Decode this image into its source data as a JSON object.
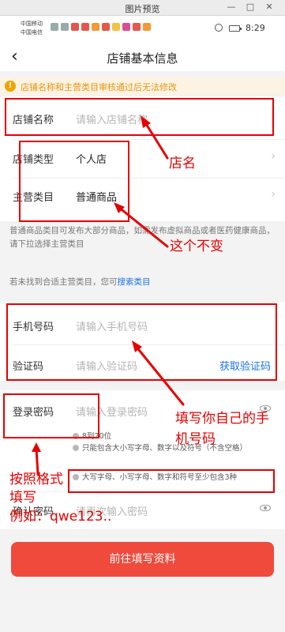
{
  "viewer": {
    "title": "图片预览",
    "controls": [
      "—",
      "□",
      "✕"
    ]
  },
  "status_bar": {
    "carrier1": "中国移动",
    "carrier2": "中国电信",
    "time": "8:29"
  },
  "nav": {
    "back_icon": "back-chevron-icon",
    "title": "店铺基本信息"
  },
  "warning": {
    "text": "店铺名称和主营类目审核通过后无法修改"
  },
  "form": {
    "store_name": {
      "label": "店铺名称",
      "placeholder": "请输入店铺名称"
    },
    "store_type": {
      "label": "店铺类型",
      "value": "个人店"
    },
    "category": {
      "label": "主营类目",
      "value": "普通商品"
    },
    "category_note": "普通商品类目可发布大部分商品，如需发布虚拟商品或者医药健康商品，请下拉选择主营类目",
    "not_found_prefix": "若未找到合适主营类目，您可",
    "not_found_link": "搜索类目",
    "phone": {
      "label": "手机号码",
      "placeholder": "请输入手机号码"
    },
    "code": {
      "label": "验证码",
      "placeholder": "请输入验证码",
      "action": "获取验证码"
    },
    "password": {
      "label": "登录密码",
      "placeholder": "请输入登录密码"
    },
    "password_rules": [
      "8到20位",
      "只能包含大小写字母、数字以及符号（不含空格）",
      "大写字母、小写字母、数字和符号至少包含3种"
    ],
    "confirm": {
      "label": "确认密码",
      "placeholder": "请再次输入密码"
    }
  },
  "submit_label": "前往填写资料",
  "annotations": {
    "store_name": "店名",
    "unchangeable": "这个不变",
    "phone": [
      "填写你自己的手",
      "机号码"
    ],
    "format": [
      "按照格式",
      "填写"
    ],
    "example": "例如：qwe123.."
  },
  "colors": {
    "accent_red": "#ef4a3c",
    "annotation_red": "#e60000",
    "link_blue": "#1a73e8",
    "warning_orange": "#e7960f"
  }
}
